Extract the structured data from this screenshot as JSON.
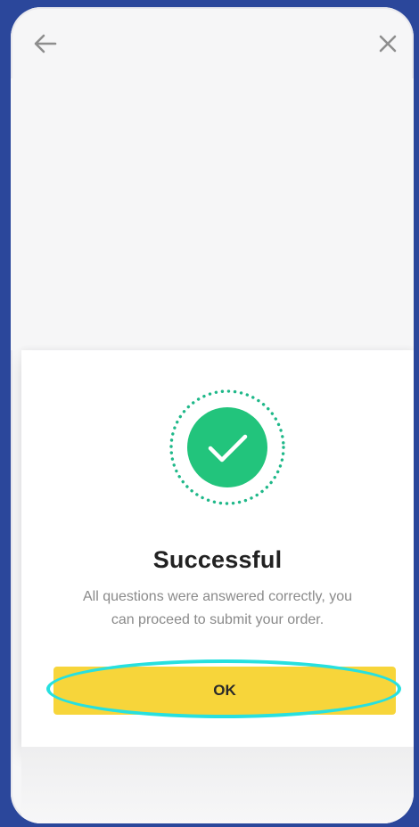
{
  "header": {
    "back_icon": "back-arrow-icon",
    "close_icon": "close-icon"
  },
  "dialog": {
    "status_icon": "check-circle-icon",
    "title": "Successful",
    "message_line1": "All questions were answered correctly, you",
    "message_line2": "can proceed to submit your order.",
    "ok_label": "OK"
  },
  "colors": {
    "background": "#2b479b",
    "success_green": "#22c47c",
    "dotted_ring": "#1fb889",
    "button_yellow": "#f7d53a",
    "highlight_cyan": "#27e0df"
  }
}
